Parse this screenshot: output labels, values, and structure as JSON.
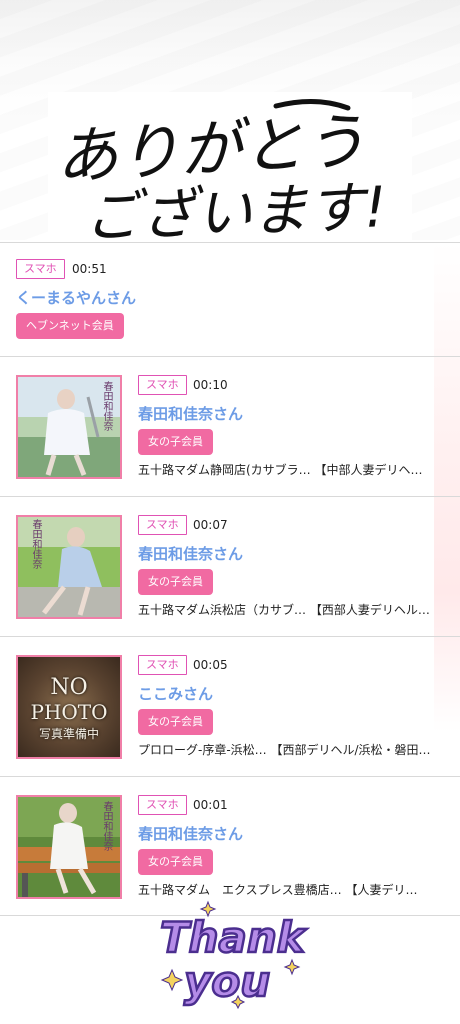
{
  "header": {
    "thanks_line1": "ありがとう",
    "thanks_line2": "ございます!"
  },
  "items": [
    {
      "badge": "スマホ",
      "time": "00:51",
      "name": "くーまるやんさん",
      "member": "ヘブンネット会員",
      "shop": ""
    },
    {
      "badge": "スマホ",
      "time": "00:10",
      "name": "春田和佳奈さん",
      "member": "女の子会員",
      "shop": "五十路マダム静岡店(カサブラ… 【中部人妻デリヘ…",
      "photo_caption": "春田和佳奈"
    },
    {
      "badge": "スマホ",
      "time": "00:07",
      "name": "春田和佳奈さん",
      "member": "女の子会員",
      "shop": "五十路マダム浜松店（カサブ… 【西部人妻デリヘル…",
      "photo_caption": "春田和佳奈"
    },
    {
      "badge": "スマホ",
      "time": "00:05",
      "name": "ここみさん",
      "member": "女の子会員",
      "shop": "プロローグ-序章-浜松… 【西部デリヘル/浜松・磐田…",
      "nophoto_line1": "NO",
      "nophoto_line2": "PHOTO",
      "nophoto_line3": "写真準備中"
    },
    {
      "badge": "スマホ",
      "time": "00:01",
      "name": "春田和佳奈さん",
      "member": "女の子会員",
      "shop": "五十路マダム　エクスプレス豊橋店… 【人妻デリ…",
      "photo_caption": "春田和佳奈"
    }
  ],
  "footer": {
    "thank": "Thank",
    "you": "you"
  },
  "colors": {
    "accent_pink": "#f16aa2",
    "badge_magenta": "#e052b4",
    "name_blue": "#6d9ce6"
  }
}
